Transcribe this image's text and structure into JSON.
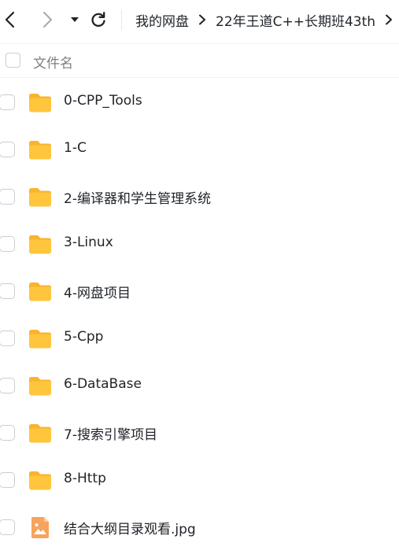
{
  "toolbar": {
    "back_icon": "chevron-left-icon",
    "forward_icon": "chevron-right-icon",
    "history_icon": "caret-down-icon",
    "refresh_icon": "refresh-icon"
  },
  "breadcrumb": {
    "items": [
      "我的网盘",
      "22年王道C++长期班43th"
    ],
    "separator_icon": "chevron-right-icon"
  },
  "list": {
    "header_label": "文件名",
    "items": [
      {
        "name": "0-CPP_Tools",
        "type": "folder"
      },
      {
        "name": "1-C",
        "type": "folder"
      },
      {
        "name": "2-编译器和学生管理系统",
        "type": "folder"
      },
      {
        "name": "3-Linux",
        "type": "folder"
      },
      {
        "name": "4-网盘项目",
        "type": "folder"
      },
      {
        "name": "5-Cpp",
        "type": "folder"
      },
      {
        "name": "6-DataBase",
        "type": "folder"
      },
      {
        "name": "7-搜索引擎项目",
        "type": "folder"
      },
      {
        "name": "8-Http",
        "type": "folder"
      },
      {
        "name": "结合大纲目录观看.jpg",
        "type": "image"
      }
    ]
  },
  "colors": {
    "folder": "#FFC53D",
    "folder_back": "#F7B42C",
    "image": "#F7A35C",
    "text": "#1f2329",
    "muted": "#7a7f87"
  }
}
